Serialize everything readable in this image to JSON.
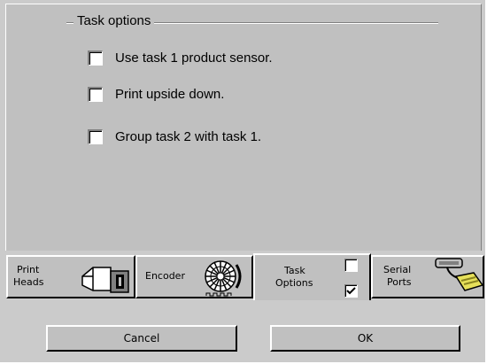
{
  "group": {
    "title": "Task options"
  },
  "options": [
    {
      "label": "Use task 1 product sensor.",
      "checked": false
    },
    {
      "label": "Print upside down.",
      "checked": false
    },
    {
      "label": "Group task 2 with task 1.",
      "checked": false
    }
  ],
  "tabs": {
    "print_heads": {
      "line1": "Print",
      "line2": "Heads",
      "icon": "print-head-icon"
    },
    "encoder": {
      "label": "Encoder",
      "icon": "encoder-wheel-icon"
    },
    "task_options": {
      "line1": "Task",
      "line2": "Options",
      "icon": "checkbox-pair-icon",
      "selected": true
    },
    "serial_ports": {
      "line1": "Serial",
      "line2": "Ports",
      "icon": "serial-cable-icon"
    }
  },
  "buttons": {
    "cancel": "Cancel",
    "ok": "OK"
  }
}
